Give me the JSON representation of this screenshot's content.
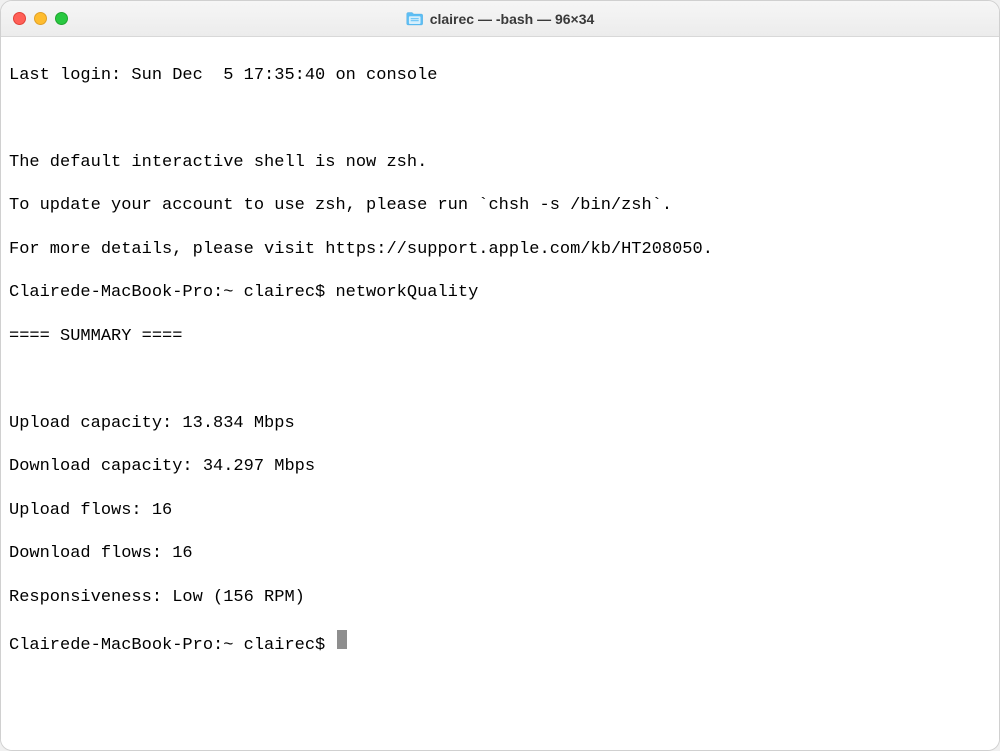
{
  "titlebar": {
    "title": "clairec — -bash — 96×34"
  },
  "terminal": {
    "last_login": "Last login: Sun Dec  5 17:35:40 on console",
    "blank1": "",
    "zsh_line1": "The default interactive shell is now zsh.",
    "zsh_line2": "To update your account to use zsh, please run `chsh -s /bin/zsh`.",
    "zsh_line3": "For more details, please visit https://support.apple.com/kb/HT208050.",
    "prompt1": "Clairede-MacBook-Pro:~ clairec$ networkQuality",
    "summary_header": "==== SUMMARY ====",
    "blank2": "",
    "upload_capacity": "Upload capacity: 13.834 Mbps",
    "download_capacity": "Download capacity: 34.297 Mbps",
    "upload_flows": "Upload flows: 16",
    "download_flows": "Download flows: 16",
    "responsiveness": "Responsiveness: Low (156 RPM)",
    "prompt2": "Clairede-MacBook-Pro:~ clairec$ "
  }
}
